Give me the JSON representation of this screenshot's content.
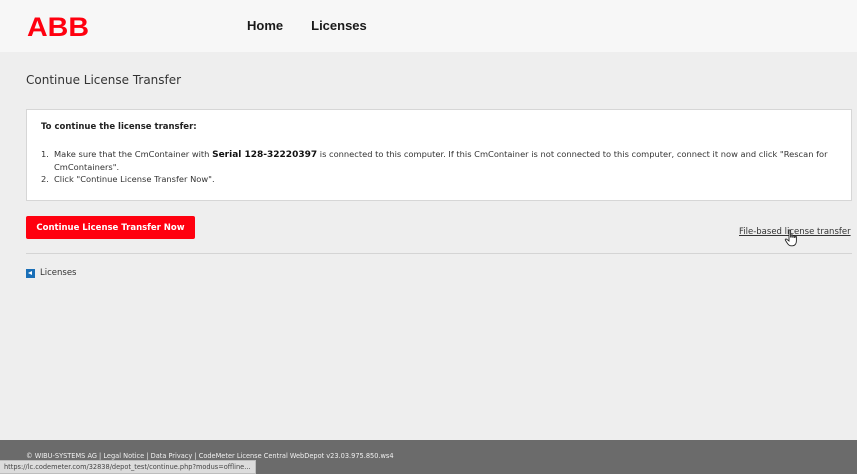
{
  "header": {
    "logo_text": "ABB",
    "nav": [
      "Home",
      "Licenses"
    ]
  },
  "main": {
    "page_title": "Continue License Transfer",
    "instructions": {
      "heading": "To continue the license transfer:",
      "step1_num": "1.",
      "step1_prefix": "Make sure that the CmContainer with ",
      "serial": "Serial 128-32220397",
      "step1_suffix": " is connected to this computer. If this CmContainer is not connected to this computer, connect it now and click \"Rescan for CmContainers\".",
      "step2_num": "2.",
      "step2": "Click \"Continue License Transfer Now\"."
    },
    "primary_button_label": "Continue License Transfer Now",
    "file_transfer_link": "File-based license transfer",
    "back_link_label": "Licenses"
  },
  "footer": {
    "text": "© WIBU-SYSTEMS AG | Legal Notice | Data Privacy | CodeMeter License Central WebDepot v23.03.975.850.ws4"
  },
  "status_bar": {
    "url": "https://lc.codemeter.com/32838/depot_test/continue.php?modus=offline..."
  },
  "colors": {
    "brand_red": "#ff000f",
    "back_icon_blue": "#1a6fb7",
    "footer_bg": "#6b6b6b"
  }
}
